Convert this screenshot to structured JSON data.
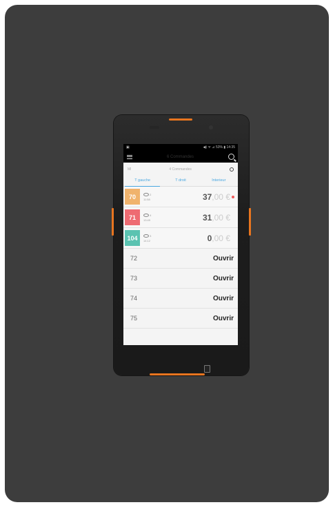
{
  "status": {
    "left": "▣",
    "right": "◀) ᯤ ⊿ 53% ▮ 14:35"
  },
  "appbar": {
    "title": "6 Commandes"
  },
  "subhead": {
    "left": "Ml",
    "center": "4 Commandes"
  },
  "tabs": [
    "T gauche",
    "T droit",
    "Interieur"
  ],
  "orders": [
    {
      "table": "70",
      "color": "#f0b36d",
      "guests": "2",
      "time": "11:58",
      "amount": "37",
      "cents": ",00 €",
      "dot": true
    },
    {
      "table": "71",
      "color": "#ee6b72",
      "guests": "4",
      "time": "13:49",
      "amount": "31",
      "cents": ",00 €",
      "dot": false
    },
    {
      "table": "104",
      "color": "#5bc3b1",
      "guests": "3",
      "time": "14:12",
      "amount": "0",
      "cents": ",00 €",
      "dot": false
    }
  ],
  "empty_tables": [
    {
      "table": "72",
      "action": "Ouvrir"
    },
    {
      "table": "73",
      "action": "Ouvrir"
    },
    {
      "table": "74",
      "action": "Ouvrir"
    },
    {
      "table": "75",
      "action": "Ouvrir"
    }
  ]
}
